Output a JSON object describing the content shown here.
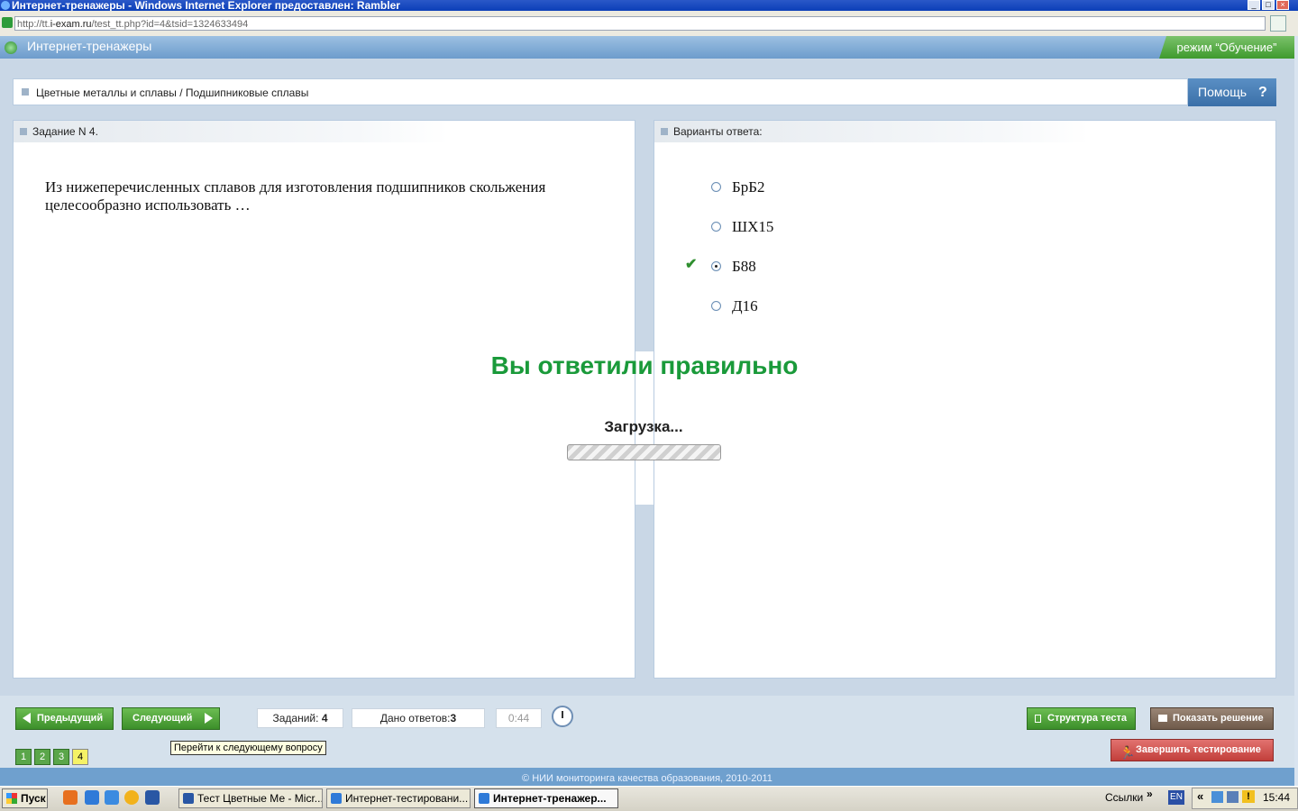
{
  "window": {
    "title": "Интернет-тренажеры - Windows Internet Explorer предоставлен: Rambler",
    "address_prefix": "http://tt.",
    "address_domain": "i-exam.ru",
    "address_path": "/test_tt.php?id=4&tsid=1324633494"
  },
  "app": {
    "title": "Интернет-тренажеры",
    "mode": "режим “Обучение”",
    "breadcrumb": "Цветные металлы и сплавы / Подшипниковые сплавы",
    "help_label": "Помощь",
    "help_symbol": "?"
  },
  "question": {
    "header": "Задание N 4.",
    "text": "Из нижеперечисленных сплавов для изготовления подшипников скольжения целесообразно использовать …"
  },
  "answers": {
    "header": "Варианты ответа:",
    "options": [
      {
        "label": "БрБ2",
        "selected": false
      },
      {
        "label": "ШХ15",
        "selected": false
      },
      {
        "label": "Б88",
        "selected": true
      },
      {
        "label": "Д16",
        "selected": false
      }
    ],
    "check_symbol": "✔"
  },
  "overlay": {
    "result": "Вы ответили правильно",
    "loading": "Загрузка..."
  },
  "toolbar": {
    "prev_label": "Предыдущий",
    "next_label": "Следующий",
    "tasks_label": "Заданий:",
    "tasks_value": "4",
    "answers_label": "Дано ответов:",
    "answers_value": "3",
    "timer": "0:44",
    "tooltip": "Перейти к следующему вопросу",
    "structure_label": "Структура теста",
    "solution_label": "Показать решение",
    "finish_label": "Завершить тестирование",
    "pages": [
      "1",
      "2",
      "3",
      "4"
    ],
    "current_page": "4"
  },
  "footer": "© НИИ мониторинга качества образования, 2010-2011",
  "taskbar": {
    "start_label": "Пуск",
    "tasks": [
      "Тест Цветные Ме - Micr...",
      "Интернет-тестировани...",
      "Интернет-тренажер..."
    ],
    "links_label": "Ссылки",
    "lang": "EN",
    "clock": "15:44"
  },
  "colors": {
    "accent_green": "#1a9a3a",
    "header_blue": "#6d9ccc",
    "finish_red": "#c23f3b"
  }
}
